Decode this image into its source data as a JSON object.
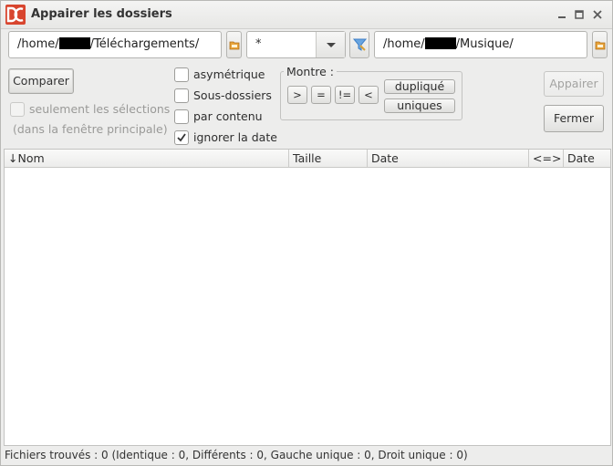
{
  "window": {
    "title": "Appairer les dossiers",
    "controls": [
      "minimize",
      "maximize",
      "close"
    ]
  },
  "paths": {
    "left": {
      "prefix": "/home/",
      "suffix": "/Téléchargements/"
    },
    "right": {
      "prefix": "/home/",
      "suffix": "/Musique/"
    }
  },
  "filter": {
    "value": "*"
  },
  "buttons": {
    "compare": "Comparer",
    "pair": "Appairer",
    "close": "Fermer"
  },
  "selection_only": {
    "label": "seulement les sélections",
    "sublabel": "(dans la fenêtre principale)",
    "checked": false
  },
  "options": [
    {
      "label": "asymétrique",
      "checked": false
    },
    {
      "label": "Sous-dossiers",
      "checked": false
    },
    {
      "label": "par contenu",
      "checked": false
    },
    {
      "label": "ignorer la date",
      "checked": true
    }
  ],
  "show": {
    "title": "Montre :",
    "buttons": [
      ">",
      "=",
      "!=",
      "<"
    ],
    "duplicated": "dupliqué",
    "unique": "uniques"
  },
  "table": {
    "columns": [
      "↓Nom",
      "Taille",
      "Date",
      "<=>",
      "Date"
    ],
    "rows": []
  },
  "status": "Fichiers trouvés : 0  (Identique : 0, Différents : 0, Gauche unique : 0, Droit unique : 0)",
  "icons": {
    "app": "double-commander-icon",
    "folder": "folder-browse-icon",
    "filter": "filter-funnel-icon",
    "check": "checkmark-icon"
  },
  "colors": {
    "app_icon_red": "#d8452e",
    "folder_orange": "#e8a33a",
    "filter_blue": "#3d7fc8"
  }
}
